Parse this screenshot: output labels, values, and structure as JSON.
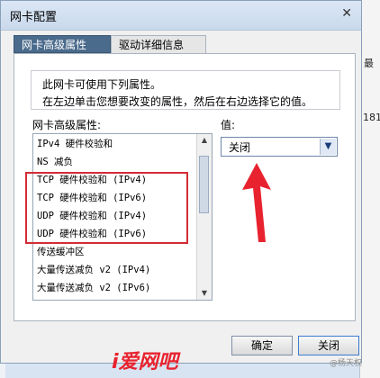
{
  "bg_window": {
    "right_col_header": "最",
    "right_col_value": "181",
    "left_mark": "–"
  },
  "dialog": {
    "title": "网卡配置",
    "close_glyph": "✕"
  },
  "tabs": [
    {
      "label": "网卡高级属性",
      "active": true
    },
    {
      "label": "驱动详细信息",
      "active": false
    }
  ],
  "info": {
    "line1": "此网卡可使用下列属性。",
    "line2": "在左边单击您想要改变的属性，然后在右边选择它的值。"
  },
  "property_label": "网卡高级属性:",
  "value_label": "值:",
  "property_list": [
    "IPv4 硬件校验和",
    "NS 减负",
    "TCP 硬件校验和 (IPv4)",
    "TCP 硬件校验和 (IPv6)",
    "UDP 硬件校验和 (IPv4)",
    "UDP 硬件校验和 (IPv6)",
    "传送缓冲区",
    "大量传送减负 v2 (IPv4)",
    "大量传送减负 v2 (IPv6)"
  ],
  "value_select": {
    "selected": "关闭"
  },
  "buttons": {
    "ok": "确定",
    "close": "关闭"
  },
  "watermark": {
    "text": "i爱网吧",
    "credit": "@杨天权"
  },
  "colors": {
    "highlight_box": "#d42c35",
    "arrow": "#e8232f",
    "active_tab": "#4b6b8c"
  }
}
